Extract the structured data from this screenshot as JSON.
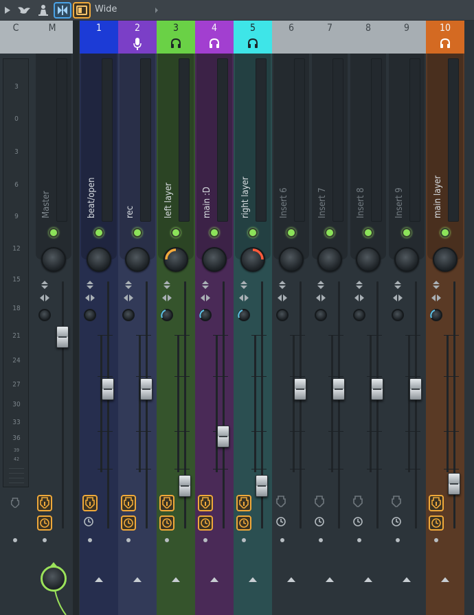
{
  "toolbar": {
    "view_mode_label": "Wide",
    "icons": [
      "play-arrow-icon",
      "bird-icon",
      "person-icon",
      "mixer-extended-icon",
      "mixer-compact-icon",
      "menu-arrow-icon"
    ]
  },
  "header": {
    "current_label": "C",
    "master_label": "M",
    "inserts": [
      {
        "num": "1",
        "color": "#1c3bd6",
        "icon": ""
      },
      {
        "num": "2",
        "color": "#7b3fc7",
        "icon": "microphone-icon"
      },
      {
        "num": "3",
        "color": "#6ad146",
        "icon": "headphones-icon"
      },
      {
        "num": "4",
        "color": "#a23fd0",
        "icon": "headphones-icon"
      },
      {
        "num": "5",
        "color": "#3ee5e8",
        "icon": "headphones-icon"
      },
      {
        "num": "6",
        "color": "",
        "icon": ""
      },
      {
        "num": "7",
        "color": "",
        "icon": ""
      },
      {
        "num": "8",
        "color": "",
        "icon": ""
      },
      {
        "num": "9",
        "color": "",
        "icon": ""
      },
      {
        "num": "10",
        "color": "#d46a22",
        "icon": "headphones-icon"
      }
    ]
  },
  "db_scale": [
    "3",
    "0",
    "3",
    "6",
    "9",
    "12",
    "15",
    "18",
    "21",
    "24",
    "27",
    "30",
    "33",
    "36",
    "39",
    "42"
  ],
  "master": {
    "name": "Master"
  },
  "tracks": [
    {
      "name": "beat/open",
      "bg": "#262e4e",
      "fader": 0.73,
      "pan": 0,
      "route_on": true,
      "fx_on": false,
      "pan_ring": ""
    },
    {
      "name": "rec",
      "bg": "#323a58",
      "fader": 0.73,
      "pan": 0,
      "route_on": true,
      "fx_on": true,
      "pan_ring": ""
    },
    {
      "name": "left layer",
      "bg": "#35542c",
      "fader": 0.26,
      "pan": -0.5,
      "route_on": true,
      "fx_on": true,
      "pan_ring": "#f2a93b"
    },
    {
      "name": "main :D",
      "bg": "#4a2a57",
      "fader": 0.5,
      "pan": 0,
      "route_on": true,
      "fx_on": true,
      "pan_ring": ""
    },
    {
      "name": "right layer",
      "bg": "#2b4f51",
      "fader": 0.26,
      "pan": 0.5,
      "route_on": true,
      "fx_on": true,
      "pan_ring": "#ff5a3a"
    },
    {
      "name": "Insert 6",
      "bg": "",
      "fader": 0.73,
      "pan": 0,
      "route_on": false,
      "fx_on": false,
      "pan_ring": ""
    },
    {
      "name": "Insert 7",
      "bg": "",
      "fader": 0.73,
      "pan": 0,
      "route_on": false,
      "fx_on": false,
      "pan_ring": ""
    },
    {
      "name": "Insert 8",
      "bg": "",
      "fader": 0.73,
      "pan": 0,
      "route_on": false,
      "fx_on": false,
      "pan_ring": ""
    },
    {
      "name": "Insert 9",
      "bg": "",
      "fader": 0.73,
      "pan": 0,
      "route_on": false,
      "fx_on": false,
      "pan_ring": ""
    },
    {
      "name": "main layer",
      "bg": "#5a3a25",
      "fader": 0.27,
      "pan": 0,
      "route_on": true,
      "fx_on": true,
      "pan_ring": ""
    }
  ]
}
